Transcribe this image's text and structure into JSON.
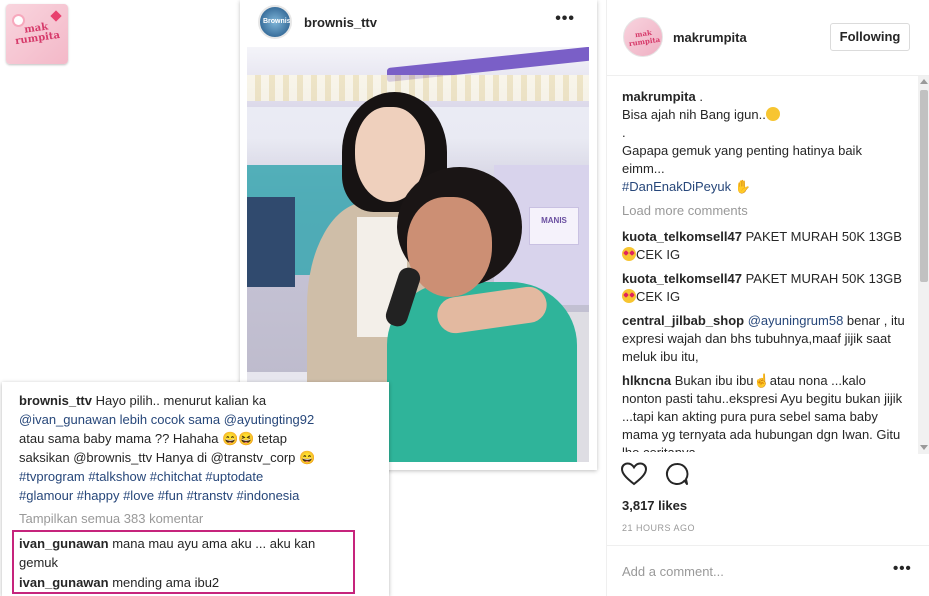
{
  "left": {
    "logo_text": "mak rumpita",
    "post": {
      "username": "brownis_ttv",
      "avatar_text": "Brownis",
      "photo_sign": "MANIS"
    },
    "overlay": {
      "caption_user": "brownis_ttv",
      "caption_lines": [
        "Hayo pilih.. menurut kalian ka",
        "@ivan_gunawan lebih cocok sama @ayutingting92",
        "atau sama baby mama ?? Hahaha 😄😆  tetap",
        "saksikan @brownis_ttv Hanya di @transtv_corp 😄",
        "#tvprogram #talkshow #chitchat #uptodate",
        "#glamour #happy #love #fun #transtv #indonesia"
      ],
      "see_all": "Tampilkan semua 383 komentar",
      "comments": [
        {
          "user": "ivan_gunawan",
          "text": "mana mau ayu ama aku ... aku kan gemuk"
        },
        {
          "user": "ivan_gunawan",
          "text": "mending ama ibu2"
        }
      ]
    }
  },
  "right": {
    "header": {
      "username": "makrumpita",
      "avatar_text": "mak rumpita",
      "follow_label": "Following"
    },
    "caption": {
      "user": "makrumpita",
      "user_suffix": " .",
      "line1": "Bisa ajah nih Bang igun..",
      "line2": ".",
      "line3": "Gapapa gemuk yang penting hatinya baik eimm...",
      "hashtag": "#DanEnakDiPeyuk"
    },
    "load_more": "Load more comments",
    "comments": [
      {
        "user": "kuota_telkomsell47",
        "text": "PAKET MURAH 50K 13GB",
        "text_after": "CEK IG"
      },
      {
        "user": "kuota_telkomsell47",
        "text": "PAKET MURAH 50K 13GB",
        "text_after": "CEK IG"
      },
      {
        "user": "central_jilbab_shop",
        "mention": "@ayuningrum58",
        "text": " benar , itu expresi wajah dan bhs tubuhnya,maaf jijik saat meluk ibu itu,"
      },
      {
        "user": "hlkncna",
        "text": "Bukan ibu ibu",
        "text_after": "atau nona ...kalo nonton pasti tahu..ekspresi Ayu begitu bukan jijik ...tapi kan akting pura pura sebel sama baby mama yg ternyata ada hubungan dgn Iwan. Gitu lho ceritanya"
      }
    ],
    "likes": "3,817 likes",
    "time": "21 HOURS AGO",
    "add_comment_placeholder": "Add a comment...",
    "icons": [
      "heart-icon",
      "comment-bubble-icon",
      "more-options-icon"
    ]
  }
}
